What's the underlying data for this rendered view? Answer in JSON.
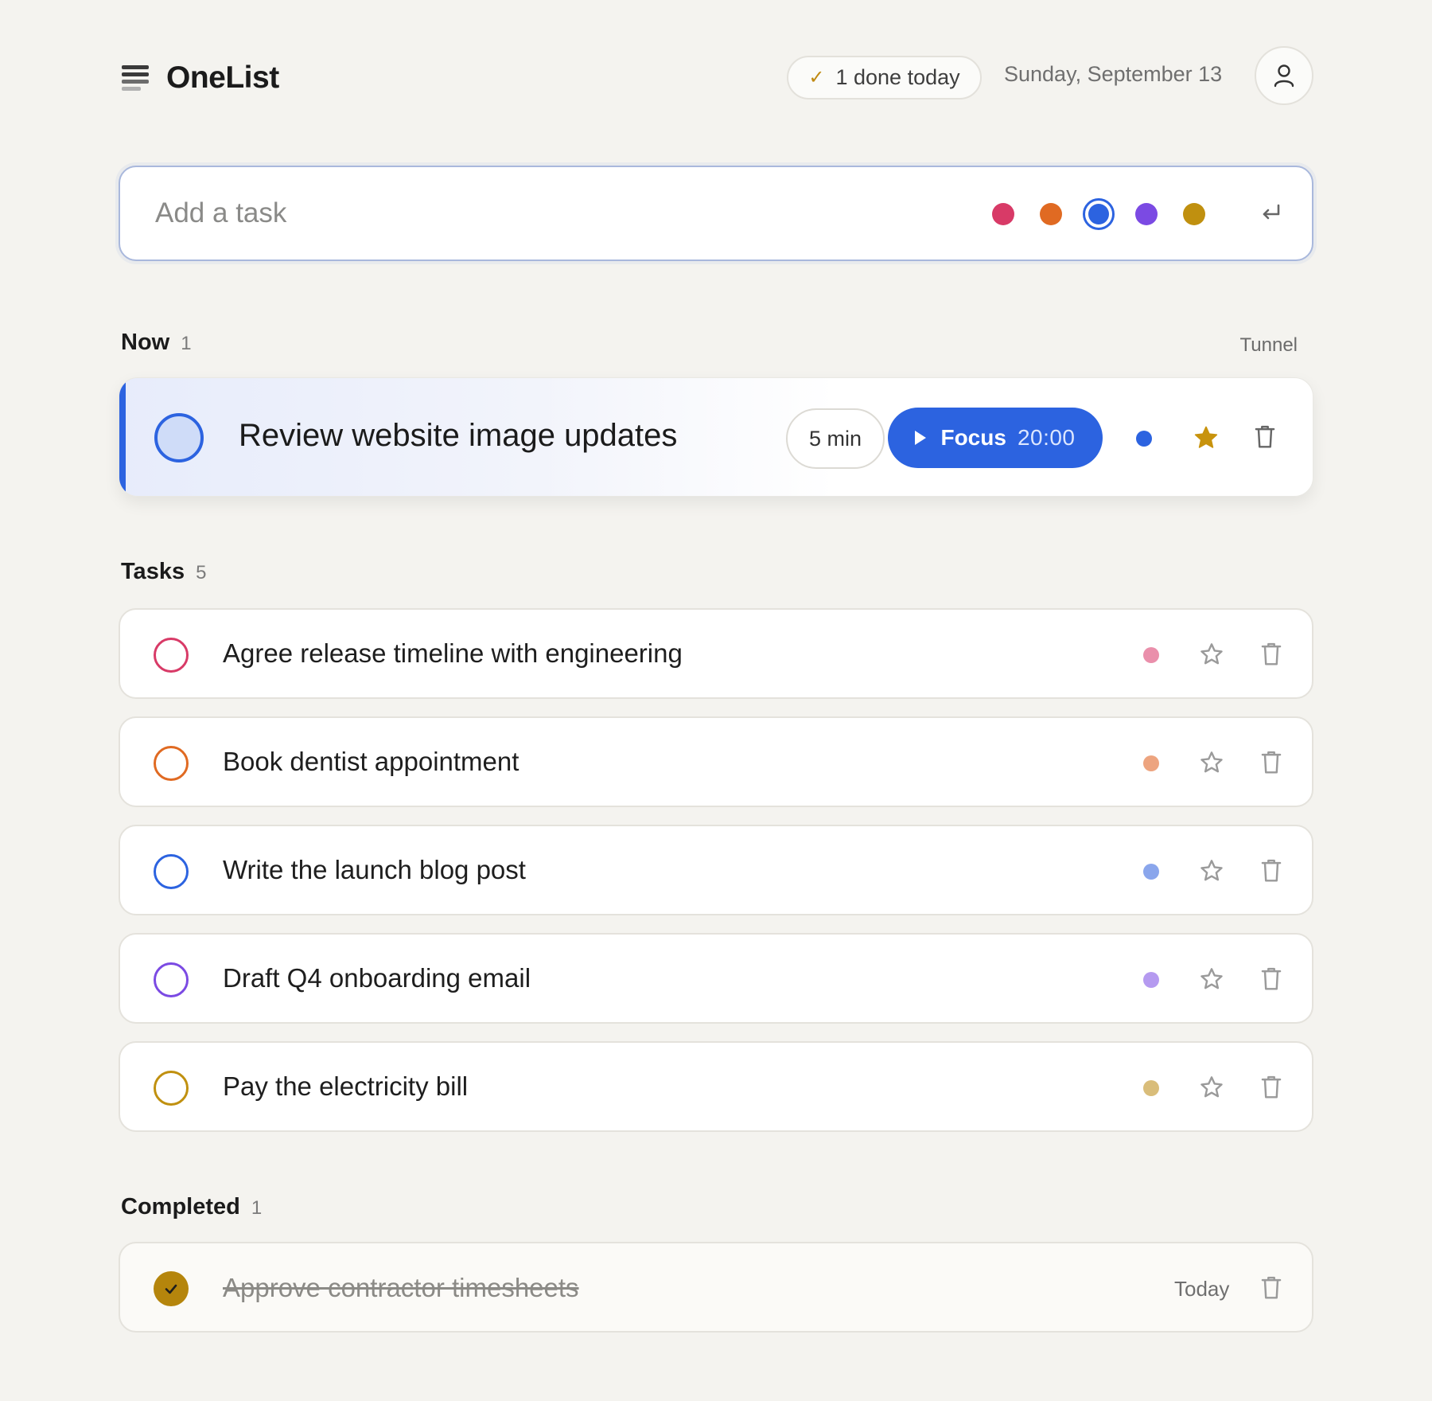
{
  "app": {
    "title": "OneList"
  },
  "header": {
    "done_count_label": "1 done today",
    "date": "Sunday, September 13"
  },
  "add_task": {
    "placeholder": "Add a task",
    "colors": [
      "#d83a67",
      "#e06a22",
      "#2c63e0",
      "#7b4ae3",
      "#c0900f"
    ],
    "selected_color": "#2c63e0"
  },
  "now_section": {
    "title": "Now",
    "count": "1",
    "tunnel_label": "Tunnel",
    "task": {
      "title": "Review website image updates",
      "duration": "5 min",
      "focus_label": "Focus",
      "timer": "20:00",
      "color": "#2c63e0",
      "starred": true
    }
  },
  "tasks_section": {
    "title": "Tasks",
    "count": "5",
    "items": [
      {
        "title": "Agree release timeline with engineering",
        "ring_color": "#d83a67",
        "dot_color": "#ea8fab",
        "starred": false
      },
      {
        "title": "Book dentist appointment",
        "ring_color": "#e06a22",
        "dot_color": "#eda47f",
        "starred": false
      },
      {
        "title": "Write the launch blog post",
        "ring_color": "#2c63e0",
        "dot_color": "#8aa6ec",
        "starred": false
      },
      {
        "title": "Draft Q4 onboarding email",
        "ring_color": "#7b4ae3",
        "dot_color": "#b59af0",
        "starred": false
      },
      {
        "title": "Pay the electricity bill",
        "ring_color": "#c0900f",
        "dot_color": "#d9bd7a",
        "starred": false
      }
    ]
  },
  "completed_section": {
    "title": "Completed",
    "count": "1",
    "items": [
      {
        "title": "Approve contractor timesheets",
        "when": "Today"
      }
    ]
  }
}
